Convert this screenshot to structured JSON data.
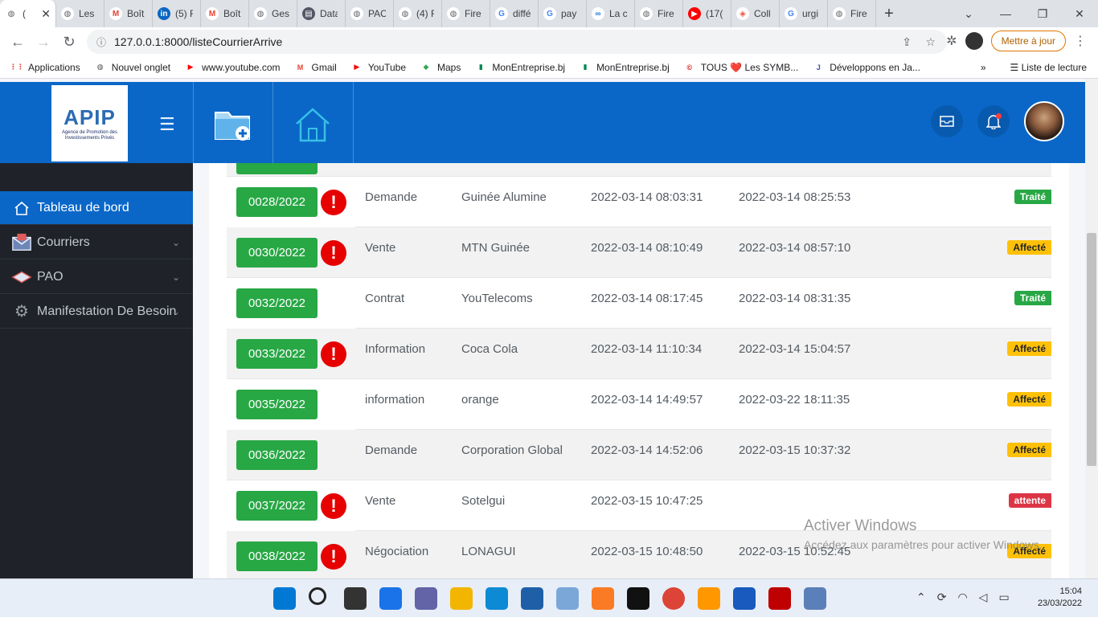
{
  "browser": {
    "tabs": [
      {
        "label": "(",
        "icon": "globe-icon",
        "active": true
      },
      {
        "label": "Les",
        "icon": "globe-icon"
      },
      {
        "label": "Boît",
        "icon": "gmail-icon"
      },
      {
        "label": "(5) F",
        "icon": "linkedin-icon"
      },
      {
        "label": "Boît",
        "icon": "gmail-icon"
      },
      {
        "label": "Ges",
        "icon": "globe-icon"
      },
      {
        "label": "Data",
        "icon": "document-icon"
      },
      {
        "label": "PAC",
        "icon": "globe-icon"
      },
      {
        "label": "(4) F",
        "icon": "globe-icon"
      },
      {
        "label": "Fire",
        "icon": "globe-icon"
      },
      {
        "label": "diffé",
        "icon": "google-icon"
      },
      {
        "label": "pay",
        "icon": "google-icon"
      },
      {
        "label": "La c",
        "icon": "infinity-icon"
      },
      {
        "label": "Fire",
        "icon": "globe-icon"
      },
      {
        "label": "(17(",
        "icon": "youtube-icon"
      },
      {
        "label": "Coll",
        "icon": "laravel-icon"
      },
      {
        "label": "urgi",
        "icon": "google-icon"
      },
      {
        "label": "Fire",
        "icon": "globe-icon"
      }
    ],
    "url": "127.0.0.1:8000/listeCourrierArrive",
    "update_label": "Mettre à jour",
    "bookmarks": [
      {
        "label": "Applications"
      },
      {
        "label": "Nouvel onglet"
      },
      {
        "label": "www.youtube.com"
      },
      {
        "label": "Gmail"
      },
      {
        "label": "YouTube"
      },
      {
        "label": "Maps"
      },
      {
        "label": "MonEntreprise.bj"
      },
      {
        "label": "MonEntreprise.bj"
      },
      {
        "label": "TOUS ❤️ Les SYMB..."
      },
      {
        "label": "Développons en Ja..."
      }
    ],
    "reading_list": "Liste de lecture"
  },
  "logo": {
    "text": "APIP",
    "subtitle": "Agence de Promotion des Investissements Privés"
  },
  "sidebar": {
    "items": [
      {
        "label": "Tableau de bord",
        "active": true
      },
      {
        "label": "Courriers"
      },
      {
        "label": "PAO"
      },
      {
        "label": "Manifestation De Besoin"
      }
    ]
  },
  "table": {
    "rows": [
      {
        "num": "0028/2022",
        "urgent": true,
        "type": "Demande",
        "sender": "Guinée Alumine",
        "date1": "2022-03-14 08:03:31",
        "date2": "2022-03-14 08:25:53",
        "status": "Traité",
        "status_color": "#28a745"
      },
      {
        "num": "0030/2022",
        "urgent": true,
        "type": "Vente",
        "sender": "MTN Guinée",
        "date1": "2022-03-14 08:10:49",
        "date2": "2022-03-14 08:57:10",
        "status": "Affecté",
        "status_color": "#ffc107"
      },
      {
        "num": "0032/2022",
        "urgent": false,
        "type": "Contrat",
        "sender": "YouTelecoms",
        "date1": "2022-03-14 08:17:45",
        "date2": "2022-03-14 08:31:35",
        "status": "Traité",
        "status_color": "#28a745"
      },
      {
        "num": "0033/2022",
        "urgent": true,
        "type": "Information",
        "sender": "Coca Cola",
        "date1": "2022-03-14 11:10:34",
        "date2": "2022-03-14 15:04:57",
        "status": "Affecté",
        "status_color": "#ffc107"
      },
      {
        "num": "0035/2022",
        "urgent": false,
        "type": "information",
        "sender": "orange",
        "date1": "2022-03-14 14:49:57",
        "date2": "2022-03-22 18:11:35",
        "status": "Affecté",
        "status_color": "#ffc107"
      },
      {
        "num": "0036/2022",
        "urgent": false,
        "type": "Demande",
        "sender": "Corporation Global",
        "date1": "2022-03-14 14:52:06",
        "date2": "2022-03-15 10:37:32",
        "status": "Affecté",
        "status_color": "#ffc107"
      },
      {
        "num": "0037/2022",
        "urgent": true,
        "type": "Vente",
        "sender": "Sotelgui",
        "date1": "2022-03-15 10:47:25",
        "date2": "",
        "status": "attente",
        "status_color": "#dc3545"
      },
      {
        "num": "0038/2022",
        "urgent": true,
        "type": "Négociation",
        "sender": "LONAGUI",
        "date1": "2022-03-15 10:48:50",
        "date2": "2022-03-15 10:52:45",
        "status": "Affecté",
        "status_color": "#ffc107"
      }
    ]
  },
  "watermark": {
    "line1": "Activer Windows",
    "line2": "Accédez aux paramètres pour activer Windows."
  },
  "taskbar": {
    "time": "15:04",
    "date": "23/03/2022"
  }
}
